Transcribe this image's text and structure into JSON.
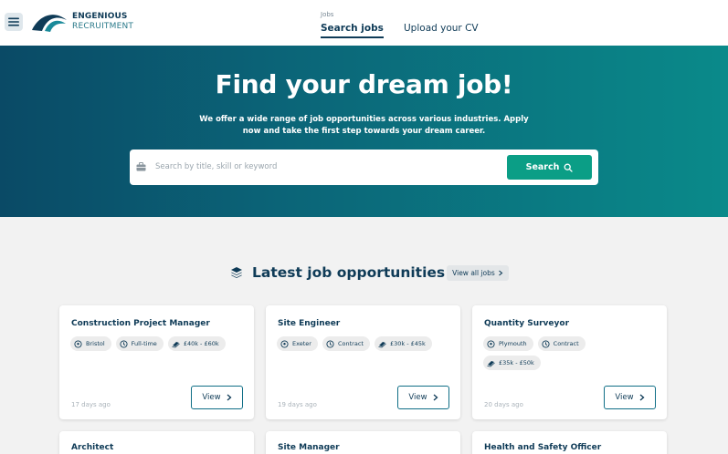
{
  "header": {
    "brand_top": "ENGENIOUS",
    "brand_bottom": "RECRUITMENT",
    "nav_group_label": "Jobs",
    "tabs": [
      {
        "label": "Search jobs",
        "active": true
      },
      {
        "label": "Upload your CV",
        "active": false
      }
    ]
  },
  "hero": {
    "title": "Find your dream job!",
    "subtitle": "We offer a wide range of job opportunities across various industries. Apply now and take the first step towards your dream career.",
    "search_placeholder": "Search by title, skill or keyword",
    "search_button": "Search",
    "gradient": [
      "#0a4a66",
      "#0a8a8a"
    ]
  },
  "section": {
    "title": "Latest job opportunities",
    "view_all": "View all jobs"
  },
  "jobs": [
    {
      "title": "Construction Project Manager",
      "location": "Bristol",
      "type": "Full-time",
      "salary": "£40k - £60k",
      "posted": "17 days ago",
      "view": "View"
    },
    {
      "title": "Site Engineer",
      "location": "Exeter",
      "type": "Contract",
      "salary": "£30k - £45k",
      "posted": "19 days ago",
      "view": "View"
    },
    {
      "title": "Quantity Surveyor",
      "location": "Plymouth",
      "type": "Contract",
      "salary": "£35k - £50k",
      "posted": "20 days ago",
      "view": "View"
    },
    {
      "title": "Architect"
    },
    {
      "title": "Site Manager"
    },
    {
      "title": "Health and Safety Officer"
    }
  ],
  "colors": {
    "primary": "#0f3b57",
    "accent": "#0b9e86",
    "background": "#f2f2f2"
  },
  "icons": [
    "menu-icon",
    "logo-icon",
    "briefcase-icon",
    "search-icon",
    "layers-icon",
    "location-icon",
    "clock-icon",
    "money-icon",
    "chevron-right-icon"
  ]
}
